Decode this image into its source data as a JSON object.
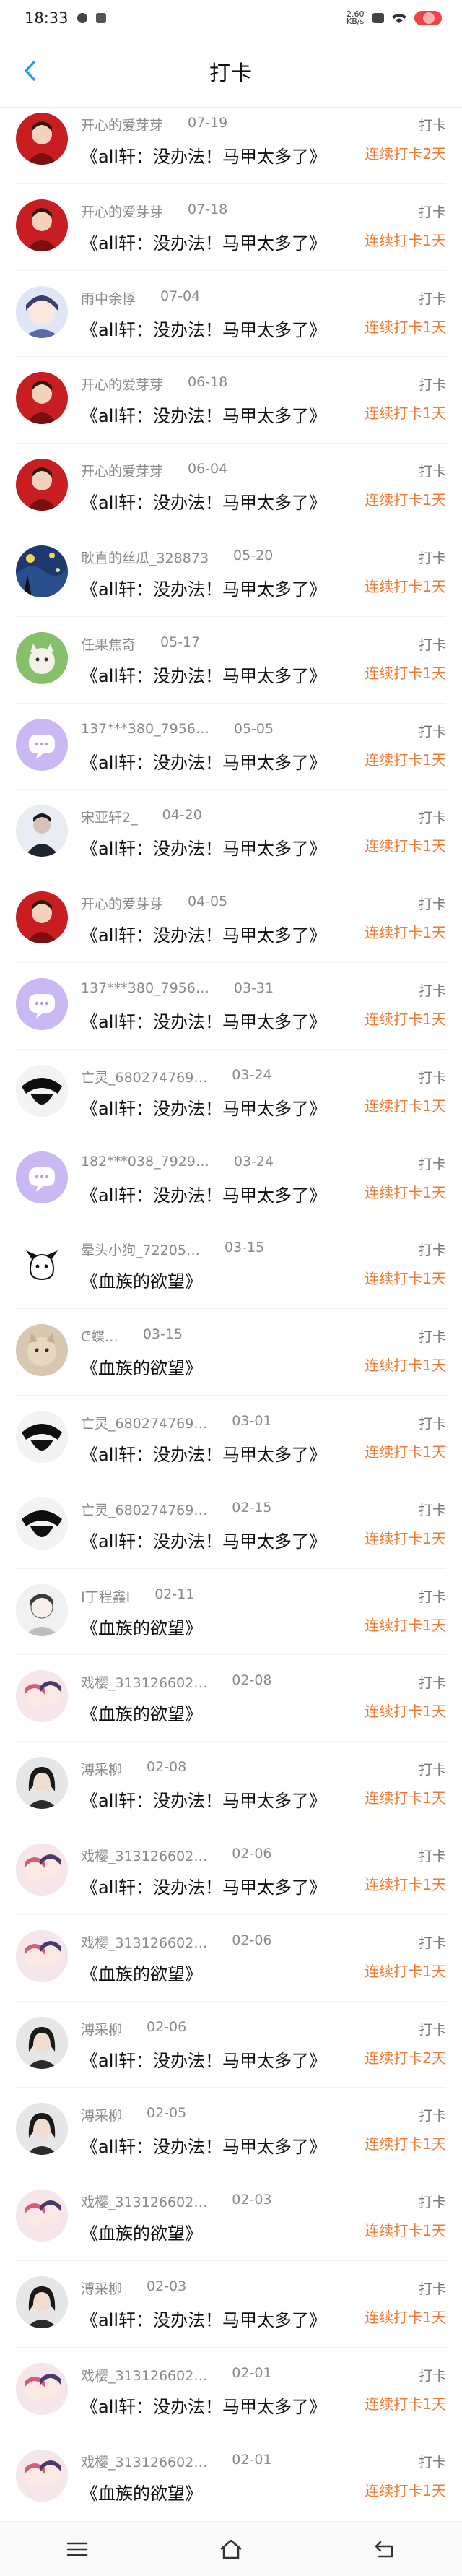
{
  "status": {
    "time": "18:33",
    "net": "2.60 KB/s"
  },
  "header": {
    "title": "打卡"
  },
  "colors": {
    "accent": "#f07a32",
    "back": "#2a9af0"
  },
  "rows": [
    {
      "name": "开心的爱芽芽",
      "date": "07-19",
      "book": "《all轩：没办法！马甲太多了》",
      "label": "打卡",
      "streak": "连续打卡2天",
      "avatar": "red-man"
    },
    {
      "name": "开心的爱芽芽",
      "date": "07-18",
      "book": "《all轩：没办法！马甲太多了》",
      "label": "打卡",
      "streak": "连续打卡1天",
      "avatar": "red-man"
    },
    {
      "name": "雨中余悸",
      "date": "07-04",
      "book": "《all轩：没办法！马甲太多了》",
      "label": "打卡",
      "streak": "连续打卡1天",
      "avatar": "anime-boy"
    },
    {
      "name": "开心的爱芽芽",
      "date": "06-18",
      "book": "《all轩：没办法！马甲太多了》",
      "label": "打卡",
      "streak": "连续打卡1天",
      "avatar": "red-man"
    },
    {
      "name": "开心的爱芽芽",
      "date": "06-04",
      "book": "《all轩：没办法！马甲太多了》",
      "label": "打卡",
      "streak": "连续打卡1天",
      "avatar": "red-man"
    },
    {
      "name": "耿直的丝瓜_328873",
      "date": "05-20",
      "book": "《all轩：没办法！马甲太多了》",
      "label": "打卡",
      "streak": "连续打卡1天",
      "avatar": "starry"
    },
    {
      "name": "任果焦奇",
      "date": "05-17",
      "book": "《all轩：没办法！马甲太多了》",
      "label": "打卡",
      "streak": "连续打卡1天",
      "avatar": "green-cat"
    },
    {
      "name": "137***380_7956…",
      "date": "05-05",
      "book": "《all轩：没办法！马甲太多了》",
      "label": "打卡",
      "streak": "连续打卡1天",
      "avatar": "purple-chat"
    },
    {
      "name": "宋亚轩2_",
      "date": "04-20",
      "book": "《all轩：没办法！马甲太多了》",
      "label": "打卡",
      "streak": "连续打卡1天",
      "avatar": "dark-person"
    },
    {
      "name": "开心的爱芽芽",
      "date": "04-05",
      "book": "《all轩：没办法！马甲太多了》",
      "label": "打卡",
      "streak": "连续打卡1天",
      "avatar": "red-man"
    },
    {
      "name": "137***380_7956…",
      "date": "03-31",
      "book": "《all轩：没办法！马甲太多了》",
      "label": "打卡",
      "streak": "连续打卡1天",
      "avatar": "purple-chat"
    },
    {
      "name": "亡灵_680274769…",
      "date": "03-24",
      "book": "《all轩：没办法！马甲太多了》",
      "label": "打卡",
      "streak": "连续打卡1天",
      "avatar": "black-hat"
    },
    {
      "name": "182***038_7929…",
      "date": "03-24",
      "book": "《all轩：没办法！马甲太多了》",
      "label": "打卡",
      "streak": "连续打卡1天",
      "avatar": "purple-chat"
    },
    {
      "name": "晕头小狗_72205…",
      "date": "03-15",
      "book": "《血族的欲望》",
      "label": "打卡",
      "streak": "连续打卡1天",
      "avatar": "doodle-dog"
    },
    {
      "name": "ᕦ蝶…",
      "date": "03-15",
      "book": "《血族的欲望》",
      "label": "打卡",
      "streak": "连续打卡1天",
      "avatar": "cat-photo"
    },
    {
      "name": "亡灵_680274769…",
      "date": "03-01",
      "book": "《all轩：没办法！马甲太多了》",
      "label": "打卡",
      "streak": "连续打卡1天",
      "avatar": "black-hat"
    },
    {
      "name": "亡灵_680274769…",
      "date": "02-15",
      "book": "《all轩：没办法！马甲太多了》",
      "label": "打卡",
      "streak": "连续打卡1天",
      "avatar": "black-hat"
    },
    {
      "name": "I丁程鑫I",
      "date": "02-11",
      "book": "《血族的欲望》",
      "label": "打卡",
      "streak": "连续打卡1天",
      "avatar": "sketch-boy"
    },
    {
      "name": "戏樱_313126602…",
      "date": "02-08",
      "book": "《血族的欲望》",
      "label": "打卡",
      "streak": "连续打卡1天",
      "avatar": "pink-anime"
    },
    {
      "name": "溥采柳",
      "date": "02-08",
      "book": "《all轩：没办法！马甲太多了》",
      "label": "打卡",
      "streak": "连续打卡1天",
      "avatar": "dark-girl"
    },
    {
      "name": "戏樱_313126602…",
      "date": "02-06",
      "book": "《all轩：没办法！马甲太多了》",
      "label": "打卡",
      "streak": "连续打卡1天",
      "avatar": "pink-anime"
    },
    {
      "name": "戏樱_313126602…",
      "date": "02-06",
      "book": "《血族的欲望》",
      "label": "打卡",
      "streak": "连续打卡1天",
      "avatar": "pink-anime"
    },
    {
      "name": "溥采柳",
      "date": "02-06",
      "book": "《all轩：没办法！马甲太多了》",
      "label": "打卡",
      "streak": "连续打卡2天",
      "avatar": "dark-girl"
    },
    {
      "name": "溥采柳",
      "date": "02-05",
      "book": "《all轩：没办法！马甲太多了》",
      "label": "打卡",
      "streak": "连续打卡1天",
      "avatar": "dark-girl"
    },
    {
      "name": "戏樱_313126602…",
      "date": "02-03",
      "book": "《血族的欲望》",
      "label": "打卡",
      "streak": "连续打卡1天",
      "avatar": "pink-anime"
    },
    {
      "name": "溥采柳",
      "date": "02-03",
      "book": "《all轩：没办法！马甲太多了》",
      "label": "打卡",
      "streak": "连续打卡1天",
      "avatar": "dark-girl"
    },
    {
      "name": "戏樱_313126602…",
      "date": "02-01",
      "book": "《all轩：没办法！马甲太多了》",
      "label": "打卡",
      "streak": "连续打卡1天",
      "avatar": "pink-anime"
    },
    {
      "name": "戏樱_313126602…",
      "date": "02-01",
      "book": "《血族的欲望》",
      "label": "打卡",
      "streak": "连续打卡1天",
      "avatar": "pink-anime"
    }
  ]
}
